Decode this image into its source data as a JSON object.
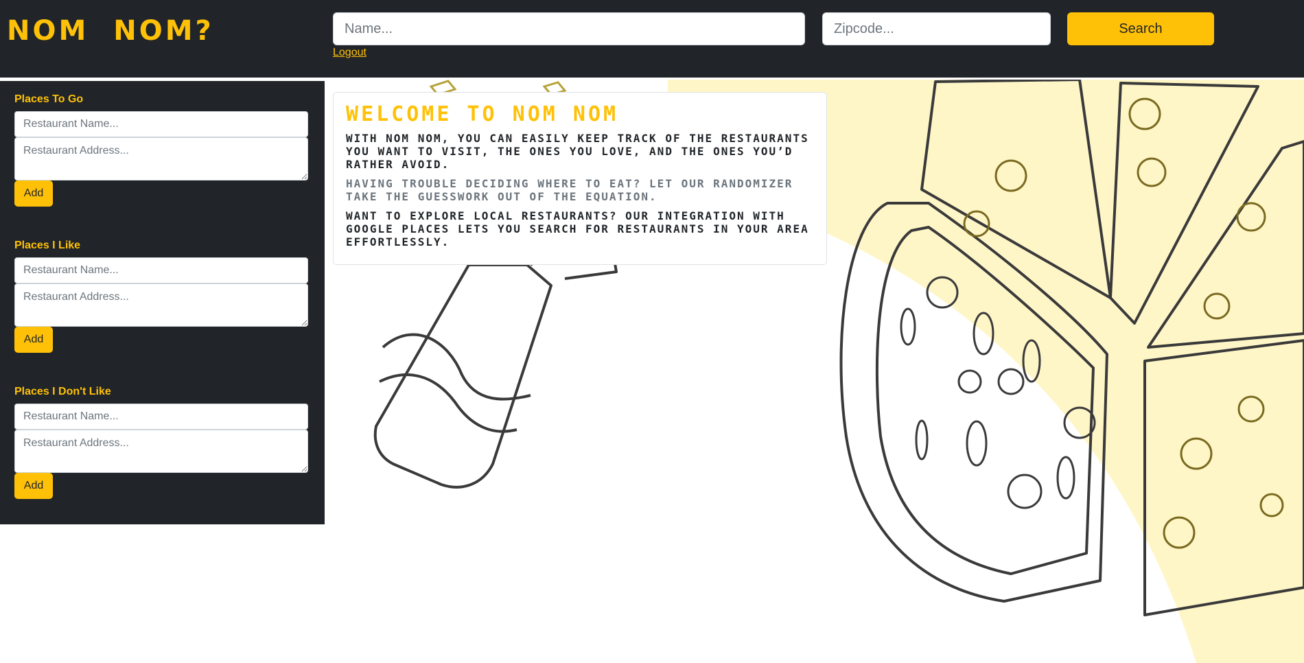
{
  "app": {
    "brand": "NOM NOM?"
  },
  "header": {
    "name_placeholder": "Name...",
    "zip_placeholder": "Zipcode...",
    "search_label": "Search",
    "logout_label": "Logout"
  },
  "sidebar": {
    "sections": [
      {
        "title": "Places To Go",
        "name_placeholder": "Restaurant Name...",
        "address_placeholder": "Restaurant Address...",
        "add_label": "Add"
      },
      {
        "title": "Places I Like",
        "name_placeholder": "Restaurant Name...",
        "address_placeholder": "Restaurant Address...",
        "add_label": "Add"
      },
      {
        "title": "Places I Don't Like",
        "name_placeholder": "Restaurant Name...",
        "address_placeholder": "Restaurant Address...",
        "add_label": "Add"
      }
    ]
  },
  "welcome": {
    "title": "Welcome to Nom Nom",
    "paragraphs": [
      "With Nom Nom, you can easily keep track of the restaurants you want to visit, the ones you love, and the ones you’d rather avoid.",
      "Having trouble deciding where to eat? Let our randomizer take the guesswork out of the equation.",
      "Want to explore local restaurants? Our integration with Google Places lets you search for restaurants in your area effortlessly."
    ]
  },
  "colors": {
    "accent": "#ffc107",
    "dark": "#212529",
    "muted": "#6c757d",
    "background_art_tint": "#fff6c8"
  },
  "icons": [
    "pizza-illustration",
    "burger-illustration",
    "fries-illustration"
  ]
}
